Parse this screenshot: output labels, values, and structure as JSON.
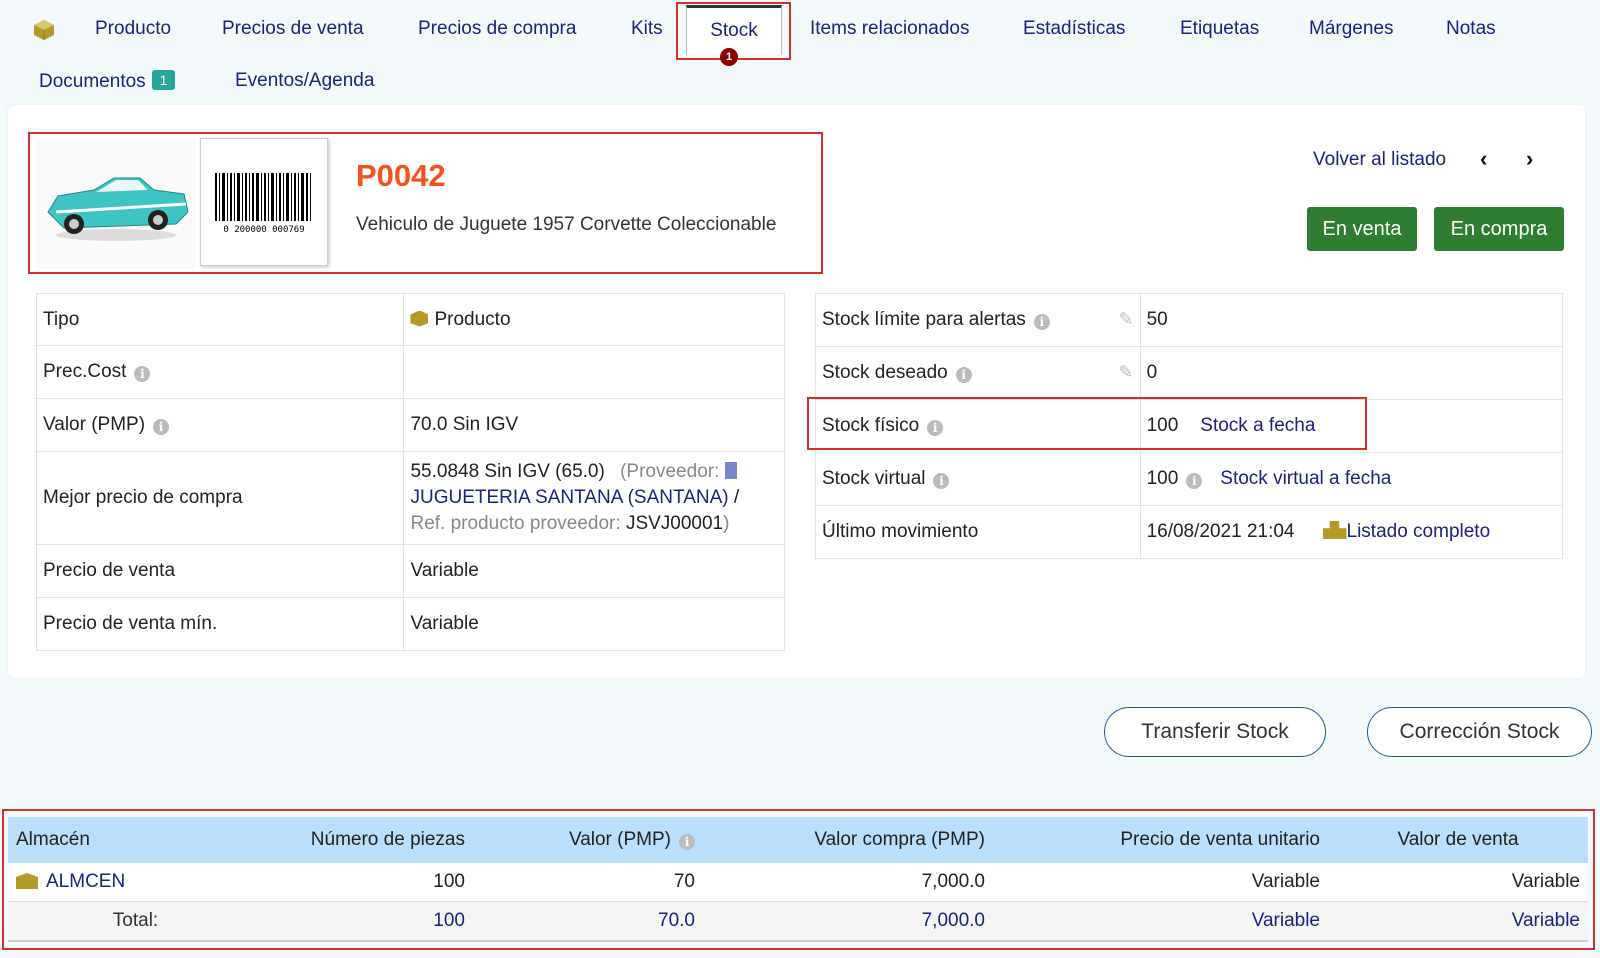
{
  "tabs": {
    "items": [
      "Producto",
      "Precios de venta",
      "Precios de compra",
      "Kits",
      "Stock",
      "Items relacionados",
      "Estadísticas",
      "Etiquetas",
      "Márgenes",
      "Notas"
    ],
    "documentos_label": "Documentos",
    "documentos_count": "1",
    "eventos_label": "Eventos/Agenda",
    "active_marker": "1"
  },
  "product": {
    "ref": "P0042",
    "description": "Vehiculo de Juguete 1957 Corvette Coleccionable",
    "barcode_number": "0 200000 000769"
  },
  "nav": {
    "back_label": "Volver al listado",
    "prev_icon": "chevron-left-icon",
    "next_icon": "chevron-right-icon"
  },
  "status_buttons": {
    "sale": "En venta",
    "purchase": "En compra"
  },
  "left_info": {
    "tipo_label": "Tipo",
    "tipo_value": "Producto",
    "prec_cost_label": "Prec.Cost",
    "valor_pmp_label": "Valor (PMP)",
    "valor_pmp_value": "70.0 Sin IGV",
    "mejor_precio_label": "Mejor precio de compra",
    "mejor_precio_value": "55.0848 Sin IGV (65.0)",
    "proveedor_prefix": "(Proveedor:",
    "proveedor_name": "JUGUETERIA SANTANA (SANTANA)",
    "ref_prov_label": "Ref. producto proveedor:",
    "ref_prov_value": "JSVJ00001",
    "precio_venta_label": "Precio de venta",
    "precio_venta_value": "Variable",
    "precio_venta_min_label": "Precio de venta mín.",
    "precio_venta_min_value": "Variable"
  },
  "right_info": {
    "limite_label": "Stock límite para alertas",
    "limite_value": "50",
    "deseado_label": "Stock deseado",
    "deseado_value": "0",
    "fisico_label": "Stock físico",
    "fisico_value": "100",
    "fisico_link": "Stock a fecha",
    "virtual_label": "Stock virtual",
    "virtual_value": "100",
    "virtual_link": "Stock virtual a fecha",
    "ultimo_label": "Último movimiento",
    "ultimo_value": "16/08/2021 21:04",
    "ultimo_link": "Listado completo"
  },
  "actions": {
    "transfer": "Transferir Stock",
    "correction": "Corrección Stock"
  },
  "stock_table": {
    "headers": [
      "Almacén",
      "Número de piezas",
      "Valor (PMP)",
      "Valor compra (PMP)",
      "Precio de venta unitario",
      "Valor de venta"
    ],
    "row": {
      "warehouse": "ALMCEN",
      "pieces": "100",
      "pmp": "70",
      "buy_pmp": "7,000.0",
      "unit_price": "Variable",
      "sale_value": "Variable"
    },
    "total": {
      "label": "Total:",
      "pieces": "100",
      "pmp": "70.0",
      "buy_pmp": "7,000.0",
      "unit_price": "Variable",
      "sale_value": "Variable"
    }
  }
}
